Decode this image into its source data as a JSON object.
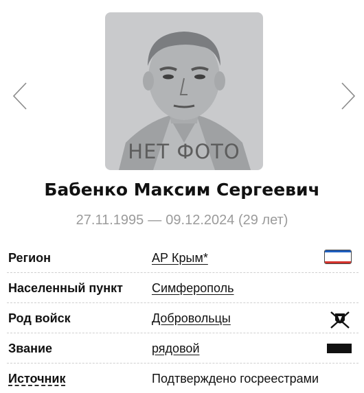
{
  "photo": {
    "caption": "НЕТ ФОТО",
    "icon": "flag-icon",
    "accent": "#e0453a"
  },
  "navigation": {
    "prev_icon": "chevron-left-icon",
    "next_icon": "chevron-right-icon"
  },
  "person": {
    "name": "Бабенко Максим Сергеевич",
    "birth": "27.11.1995",
    "separator": "—",
    "death": "09.12.2024",
    "age": "(29 лет)"
  },
  "details": {
    "region": {
      "label": "Регион",
      "value": "АР Крым*",
      "icon": "crimea-flag-icon"
    },
    "locality": {
      "label": "Населенный пункт",
      "value": "Симферополь"
    },
    "branch": {
      "label": "Род войск",
      "value": "Добровольцы",
      "icon": "volunteers-emblem-icon"
    },
    "rank": {
      "label": "Звание",
      "value": "рядовой",
      "icon": "rank-insignia-icon"
    },
    "source": {
      "label": "Источник",
      "value": "Подтверждено госреестрами"
    }
  },
  "colors": {
    "muted_text": "#9b9b9b",
    "divider": "#cfcfcf",
    "placeholder_bg": "#c9cacc"
  }
}
